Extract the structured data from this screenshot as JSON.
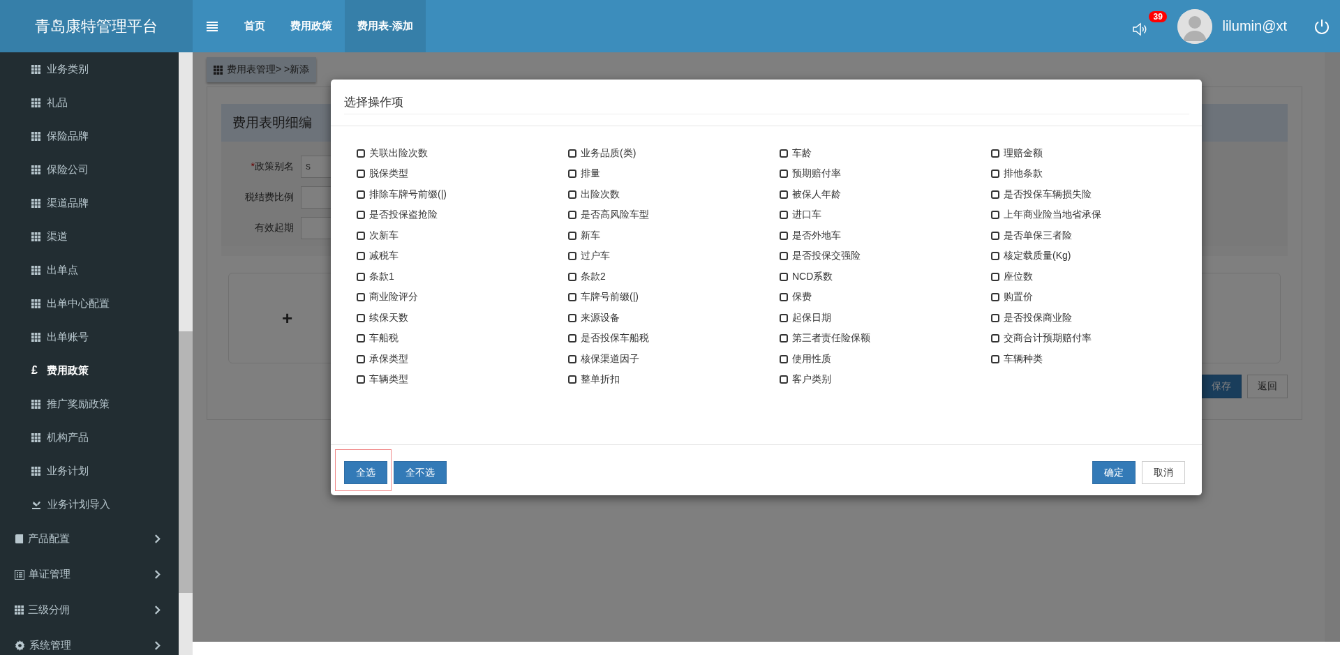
{
  "header": {
    "brand": "青岛康特管理平台",
    "nav": [
      {
        "label": "首页",
        "selected": false
      },
      {
        "label": "费用政策",
        "selected": false
      },
      {
        "label": "费用表-添加",
        "selected": true
      }
    ],
    "notification_count": "39",
    "username": "lilumin@xt"
  },
  "sidebar": {
    "sub_items": [
      {
        "label": "业务类别",
        "selected": false
      },
      {
        "label": "礼品",
        "selected": false
      },
      {
        "label": "保险品牌",
        "selected": false
      },
      {
        "label": "保险公司",
        "selected": false
      },
      {
        "label": "渠道品牌",
        "selected": false
      },
      {
        "label": "渠道",
        "selected": false
      },
      {
        "label": "出单点",
        "selected": false
      },
      {
        "label": "出单中心配置",
        "selected": false
      },
      {
        "label": "出单账号",
        "selected": false
      },
      {
        "label": "费用政策",
        "selected": true,
        "glyph": "£"
      },
      {
        "label": "推广奖励政策",
        "selected": false
      },
      {
        "label": "机构产品",
        "selected": false
      },
      {
        "label": "业务计划",
        "selected": false
      },
      {
        "label": "业务计划导入",
        "selected": false
      }
    ],
    "groups": [
      {
        "label": "产品配置",
        "expanded": false
      },
      {
        "label": "单证管理",
        "expanded": false
      },
      {
        "label": "三级分佣",
        "expanded": false
      },
      {
        "label": "系统管理",
        "expanded": false
      }
    ]
  },
  "page": {
    "breadcrumb": "费用表管理> >新添",
    "panel_title": "费用表明细编",
    "required_mark": "*",
    "fields": [
      {
        "label": "政策别名",
        "required": true,
        "value": "s"
      },
      {
        "label": "税结费比例",
        "required": false
      },
      {
        "label": "有效起期",
        "required": false
      }
    ],
    "add_symbol": "+",
    "buttons": [
      "保存",
      "返回"
    ]
  },
  "dialog": {
    "title": "选择操作项",
    "options": [
      {
        "label": "关联出险次数",
        "checked": false
      },
      {
        "label": "业务品质(类)",
        "checked": false
      },
      {
        "label": "车龄",
        "checked": false
      },
      {
        "label": "理赔金额",
        "checked": false
      },
      {
        "label": "脱保类型",
        "checked": false
      },
      {
        "label": "排量",
        "checked": false
      },
      {
        "label": "预期赔付率",
        "checked": false
      },
      {
        "label": "排他条款",
        "checked": false
      },
      {
        "label": "排除车牌号前缀(|)",
        "checked": false
      },
      {
        "label": "出险次数",
        "checked": false
      },
      {
        "label": "被保人年龄",
        "checked": false
      },
      {
        "label": "是否投保车辆损失险",
        "checked": false
      },
      {
        "label": "是否投保盗抢险",
        "checked": false
      },
      {
        "label": "是否高风险车型",
        "checked": false
      },
      {
        "label": "进口车",
        "checked": false
      },
      {
        "label": "上年商业险当地省承保",
        "checked": false
      },
      {
        "label": "次新车",
        "checked": false
      },
      {
        "label": "新车",
        "checked": false
      },
      {
        "label": "是否外地车",
        "checked": false
      },
      {
        "label": "是否单保三者险",
        "checked": false
      },
      {
        "label": "减税车",
        "checked": false
      },
      {
        "label": "过户车",
        "checked": false
      },
      {
        "label": "是否投保交强险",
        "checked": false
      },
      {
        "label": "核定载质量(Kg)",
        "checked": false
      },
      {
        "label": "条款1",
        "checked": false
      },
      {
        "label": "条款2",
        "checked": false
      },
      {
        "label": "NCD系数",
        "checked": false
      },
      {
        "label": "座位数",
        "checked": false
      },
      {
        "label": "商业险评分",
        "checked": false
      },
      {
        "label": "车牌号前缀(|)",
        "checked": false
      },
      {
        "label": "保费",
        "checked": false
      },
      {
        "label": "购置价",
        "checked": false
      },
      {
        "label": "续保天数",
        "checked": false
      },
      {
        "label": "来源设备",
        "checked": false
      },
      {
        "label": "起保日期",
        "checked": false
      },
      {
        "label": "是否投保商业险",
        "checked": false
      },
      {
        "label": "车船税",
        "checked": false
      },
      {
        "label": "是否投保车船税",
        "checked": false
      },
      {
        "label": "第三者责任险保额",
        "checked": false
      },
      {
        "label": "交商合计预期赔付率",
        "checked": false
      },
      {
        "label": "承保类型",
        "checked": false
      },
      {
        "label": "核保渠道因子",
        "checked": false
      },
      {
        "label": "使用性质",
        "checked": false
      },
      {
        "label": "车辆种类",
        "checked": false
      },
      {
        "label": "车辆类型",
        "checked": false
      },
      {
        "label": "整单折扣",
        "checked": false
      },
      {
        "label": "客户类别",
        "checked": false
      }
    ],
    "left_buttons": [
      {
        "label": "全选",
        "kind": "primary",
        "focused": true
      },
      {
        "label": "全不选",
        "kind": "primary",
        "focused": false
      }
    ],
    "right_buttons": [
      {
        "label": "确定",
        "kind": "primary",
        "focused": false
      },
      {
        "label": "取消",
        "kind": "default",
        "focused": false
      }
    ]
  }
}
